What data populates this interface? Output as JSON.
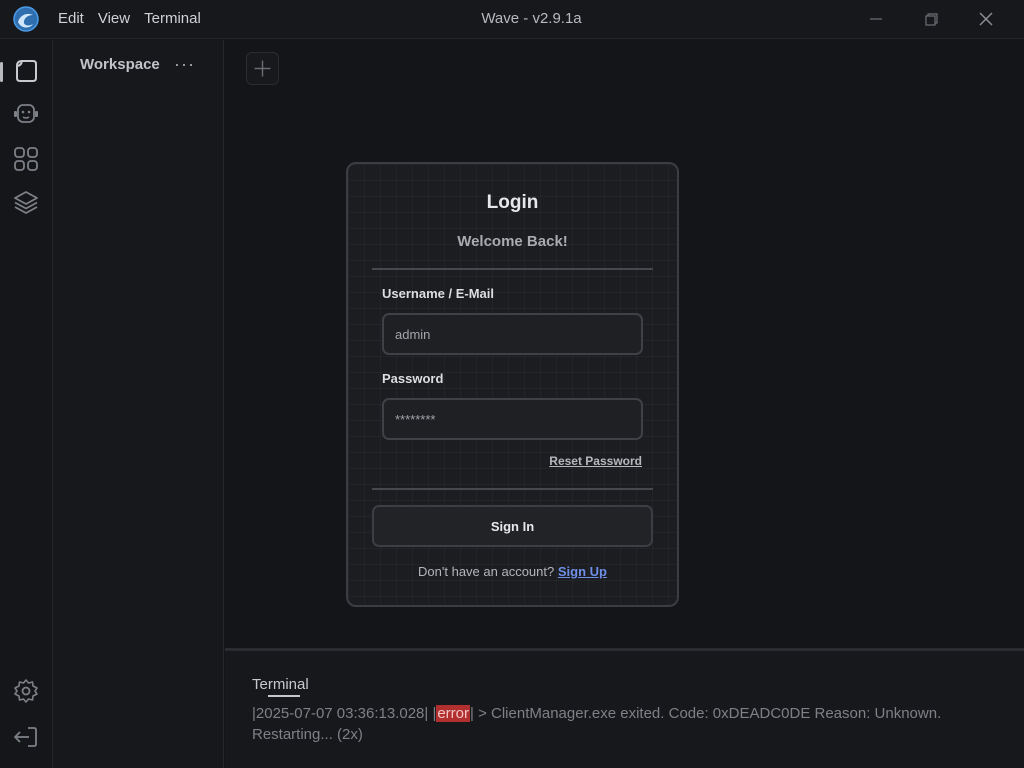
{
  "app": {
    "title": "Wave - v2.9.1a",
    "menu": [
      "Edit",
      "View",
      "Terminal"
    ]
  },
  "rail": {
    "icons": [
      "pages-icon",
      "robot-icon",
      "apps-grid-icon",
      "layers-icon",
      "settings-icon",
      "logout-icon"
    ]
  },
  "sidebar": {
    "title": "Workspace",
    "more": "···"
  },
  "login": {
    "title": "Login",
    "subtitle": "Welcome Back!",
    "username_label": "Username / E-Mail",
    "username_value": "admin",
    "password_label": "Password",
    "password_value": "********",
    "reset_label": "Reset Password",
    "signin_label": "Sign In",
    "signup_prompt": "Don't have an account?",
    "signup_link": "Sign Up"
  },
  "terminal": {
    "tab": "Terminal",
    "log_prefix": "|2025-07-07 03:36:13.028| |",
    "log_level": "error",
    "log_suffix": "| > ClientManager.exe exited. Code: 0xDEADC0DE Reason: Unknown. Restarting... (2x)"
  },
  "colors": {
    "accent_link": "#6f8fe6",
    "error_badge": "#b22f2f",
    "logo": "#3f8fd8"
  }
}
